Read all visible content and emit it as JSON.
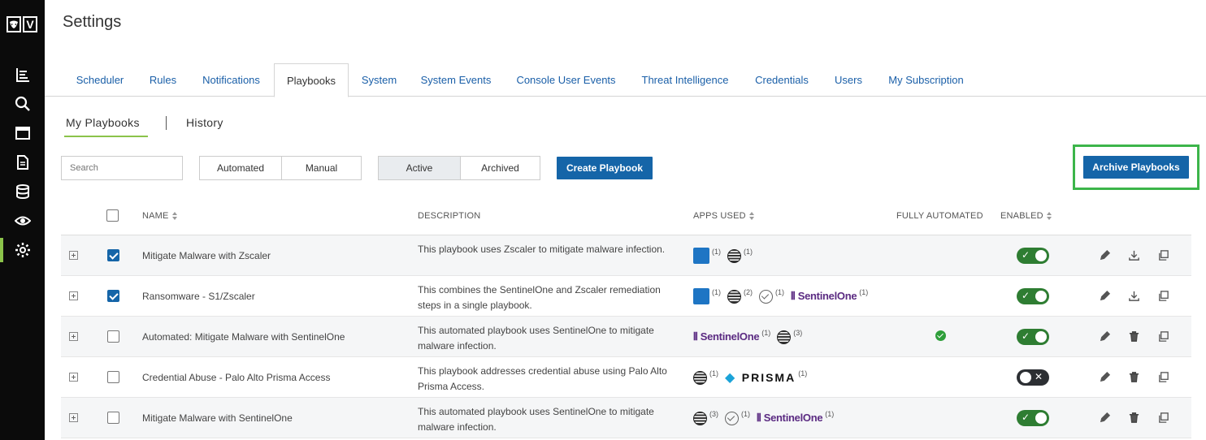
{
  "app": {
    "logo_text": "V",
    "page_title": "Settings"
  },
  "sidebar": {
    "items": [
      {
        "name": "dashboard",
        "icon": "bar-list-icon"
      },
      {
        "name": "search",
        "icon": "search-icon"
      },
      {
        "name": "browser",
        "icon": "window-icon"
      },
      {
        "name": "reports",
        "icon": "document-icon"
      },
      {
        "name": "data",
        "icon": "database-icon"
      },
      {
        "name": "monitor",
        "icon": "eye-icon"
      },
      {
        "name": "settings",
        "icon": "gear-icon",
        "active": true
      }
    ]
  },
  "tabs": [
    "Scheduler",
    "Rules",
    "Notifications",
    "Playbooks",
    "System",
    "System Events",
    "Console User Events",
    "Threat Intelligence",
    "Credentials",
    "Users",
    "My Subscription"
  ],
  "active_tab": "Playbooks",
  "subtabs": {
    "my_playbooks": "My Playbooks",
    "history": "History"
  },
  "toolbar": {
    "search_placeholder": "Search",
    "mode_filter": {
      "automated": "Automated",
      "manual": "Manual"
    },
    "state_filter": {
      "active": "Active",
      "archived": "Archived",
      "selected": "Active"
    },
    "create_label": "Create Playbook",
    "archive_label": "Archive Playbooks"
  },
  "table": {
    "headers": {
      "name": "NAME",
      "description": "DESCRIPTION",
      "apps_used": "APPS USED",
      "fully_automated": "FULLY AUTOMATED",
      "enabled": "ENABLED"
    },
    "rows": [
      {
        "name": "Mitigate Malware with Zscaler",
        "description": "This playbook uses Zscaler to mitigate malware infection.",
        "checked": true,
        "apps": [
          {
            "app": "zscaler",
            "count": "(1)"
          },
          {
            "app": "att",
            "count": "(1)"
          }
        ],
        "fully_automated": false,
        "enabled": true,
        "actions": [
          "edit-icon",
          "download-icon",
          "copy-icon"
        ]
      },
      {
        "name": "Ransomware - S1/Zscaler",
        "description": "This combines the SentinelOne and Zscaler remediation steps in a single playbook.",
        "checked": true,
        "apps": [
          {
            "app": "zscaler",
            "count": "(1)"
          },
          {
            "app": "att",
            "count": "(2)"
          },
          {
            "app": "check",
            "count": "(1)"
          },
          {
            "app": "sentinelone",
            "label": "SentinelOne",
            "count": "(1)"
          }
        ],
        "fully_automated": false,
        "enabled": true,
        "actions": [
          "edit-icon",
          "download-icon",
          "copy-icon"
        ]
      },
      {
        "name": "Automated: Mitigate Malware with SentinelOne",
        "description": "This automated playbook uses SentinelOne to mitigate malware infection.",
        "checked": false,
        "apps": [
          {
            "app": "sentinelone",
            "label": "SentinelOne",
            "count": "(1)"
          },
          {
            "app": "att",
            "count": "(3)"
          }
        ],
        "fully_automated": true,
        "enabled": true,
        "actions": [
          "edit-icon",
          "trash-icon",
          "copy-icon"
        ]
      },
      {
        "name": "Credential Abuse - Palo Alto Prisma Access",
        "description": "This playbook addresses credential abuse using Palo Alto Prisma Access.",
        "checked": false,
        "apps": [
          {
            "app": "att",
            "count": "(1)"
          },
          {
            "app": "prisma",
            "label": "PRISMA",
            "count": "(1)"
          }
        ],
        "fully_automated": false,
        "enabled": false,
        "actions": [
          "edit-icon",
          "trash-icon",
          "copy-icon"
        ]
      },
      {
        "name": "Mitigate Malware with SentinelOne",
        "description": "This automated playbook uses SentinelOne to mitigate malware infection.",
        "checked": false,
        "apps": [
          {
            "app": "att",
            "count": "(3)"
          },
          {
            "app": "check",
            "count": "(1)"
          },
          {
            "app": "sentinelone",
            "label": "SentinelOne",
            "count": "(1)"
          }
        ],
        "fully_automated": false,
        "enabled": true,
        "actions": [
          "edit-icon",
          "trash-icon",
          "copy-icon"
        ]
      }
    ]
  },
  "colors": {
    "accent": "#1565a8",
    "active_marker": "#8bc34a",
    "highlight": "#3cb54a",
    "enabled": "#2e7d32",
    "disabled": "#2c2f33"
  }
}
